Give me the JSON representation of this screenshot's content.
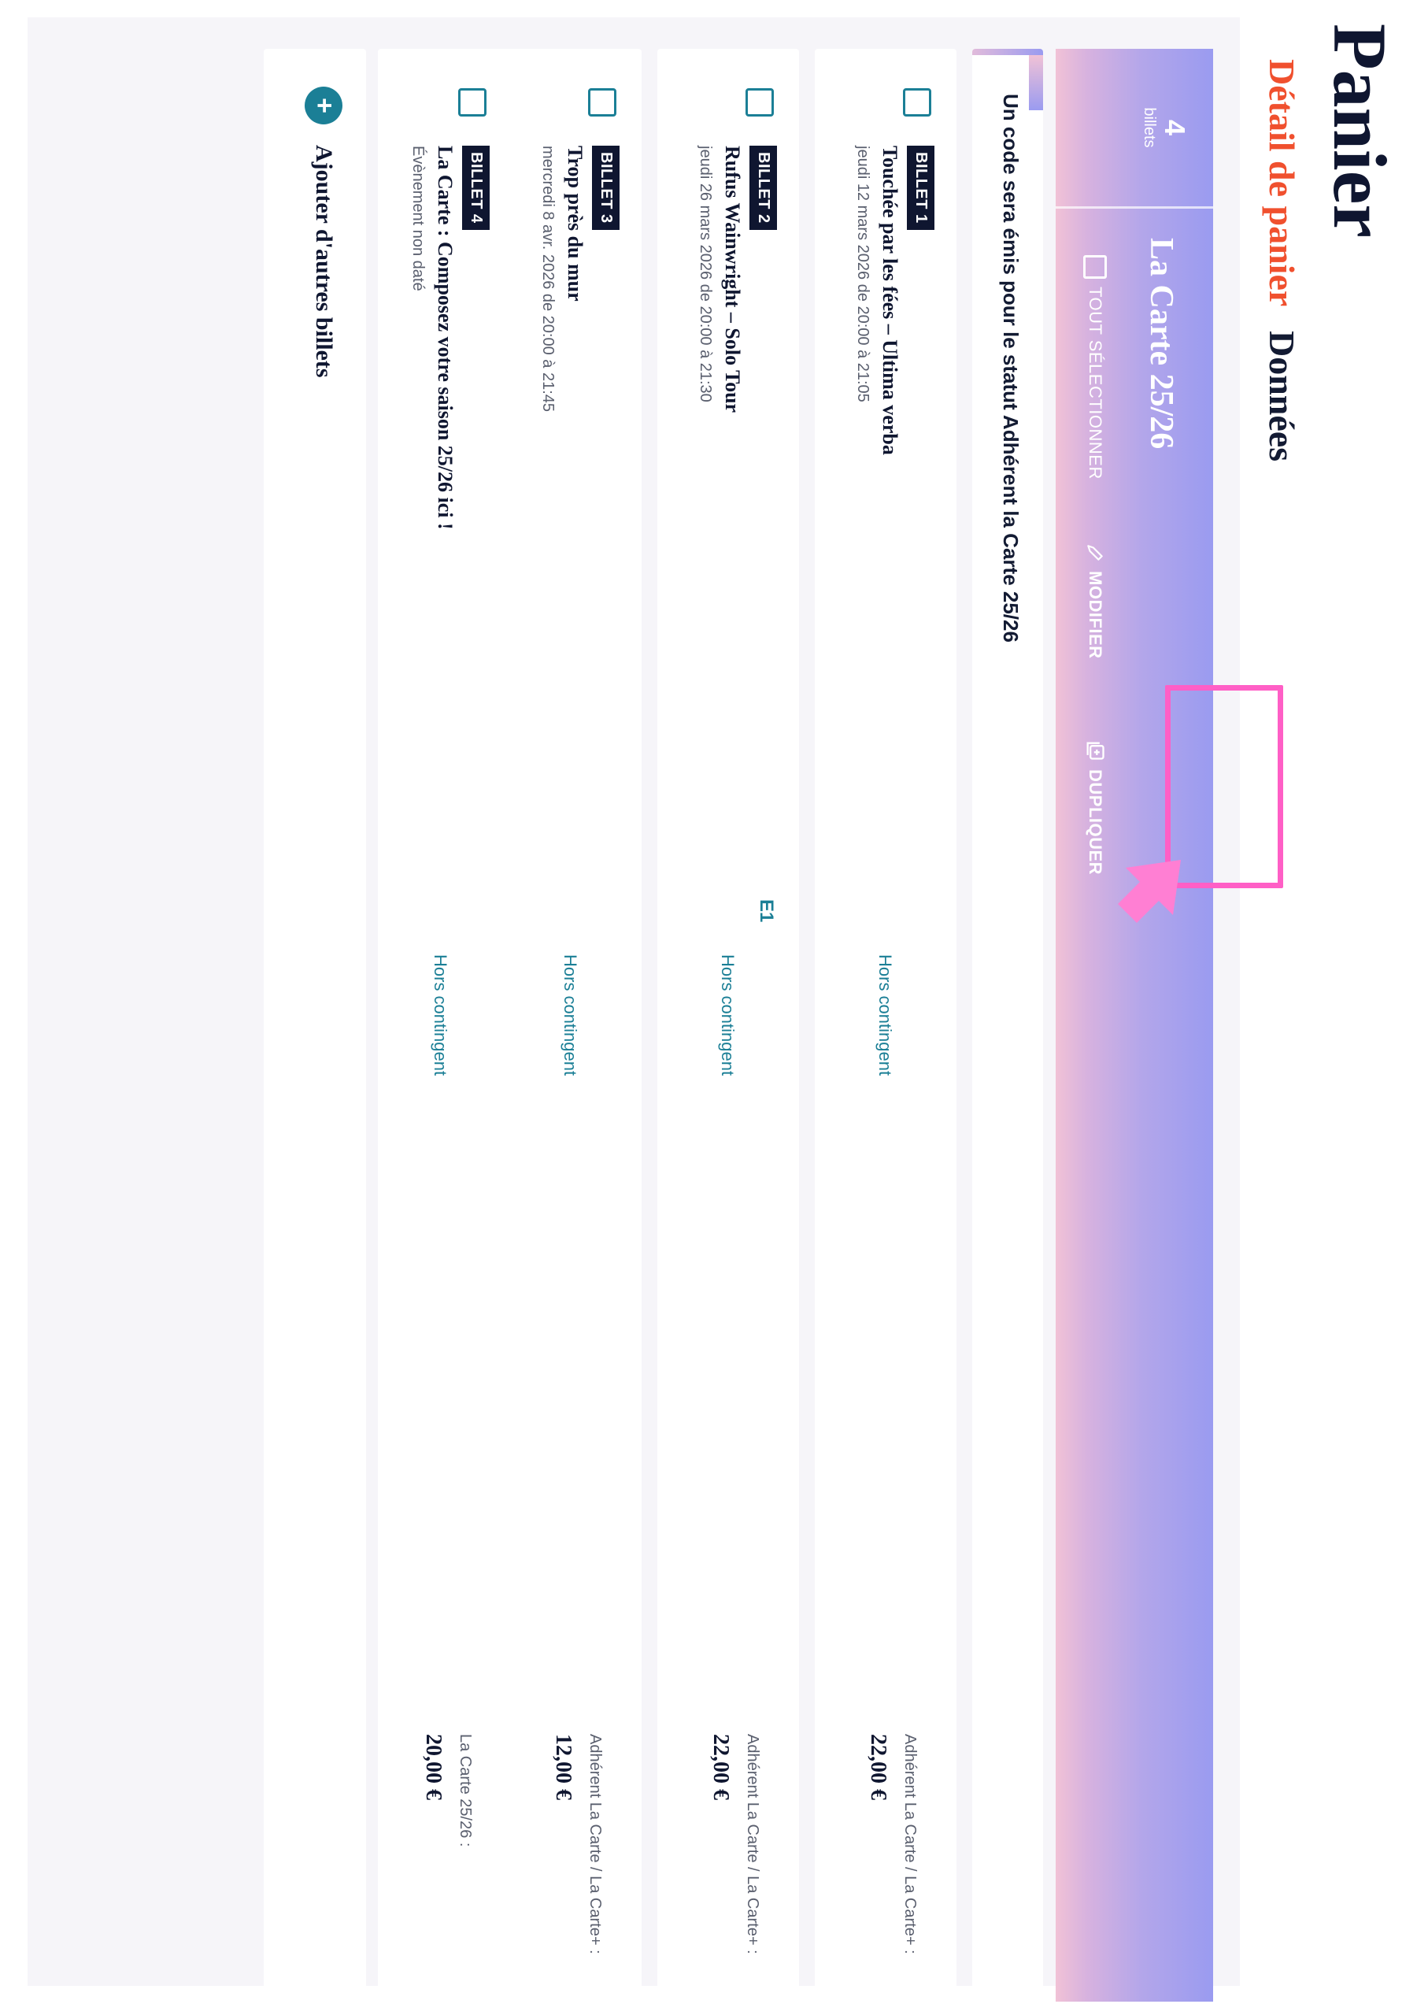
{
  "page": {
    "title": "Panier"
  },
  "tabs": [
    {
      "label": "Détail de panier",
      "active": true
    },
    {
      "label": "Données",
      "active": false
    }
  ],
  "colors": {
    "accent": "#f0502e",
    "teal": "#1b7f96",
    "navy": "#0f1630",
    "highlight": "#ff5fc6",
    "gradient_start": "#9a9bf0",
    "gradient_end": "#f1c2d6"
  },
  "group": {
    "count": "4",
    "count_label": "billets",
    "title": "La Carte 25/26",
    "actions": {
      "select_all": "TOUT SÉLECTIONNER",
      "modify": "MODIFIER",
      "duplicate": "DUPLIQUER"
    },
    "info": "Un code sera émis pour le statut Adhérent la Carte 25/26"
  },
  "tickets": [
    {
      "badge": "BILLET 1",
      "name": "Touchée par les fées – Ultima verba",
      "date": "jeudi 12 mars 2026 de 20:00 à 21:05",
      "seat": "",
      "contingent": "Hors contingent",
      "price_label": "Adhérent La Carte / La Carte+ :",
      "price": "22,00 €"
    },
    {
      "badge": "BILLET 2",
      "name": "Rufus Wainwright – Solo Tour",
      "date": "jeudi 26 mars 2026 de 20:00 à 21:30",
      "seat": "E1",
      "contingent": "Hors contingent",
      "price_label": "Adhérent La Carte / La Carte+ :",
      "price": "22,00 €"
    },
    {
      "badge": "BILLET 3",
      "name": "Trop près du mur",
      "date": "mercredi 8 avr. 2026 de 20:00 à 21:45",
      "seat": "",
      "contingent": "Hors contingent",
      "price_label": "Adhérent La Carte / La Carte+ :",
      "price": "12,00 €"
    },
    {
      "badge": "BILLET 4",
      "name": "La Carte : Composez votre saison 25/26 ici !",
      "date": "Évènement non daté",
      "seat": "",
      "contingent": "Hors contingent",
      "price_label": "La Carte 25/26 :",
      "price": "20,00 €"
    }
  ],
  "add_more": {
    "label": "Ajouter d'autres billets",
    "icon": "plus-circle-icon"
  }
}
